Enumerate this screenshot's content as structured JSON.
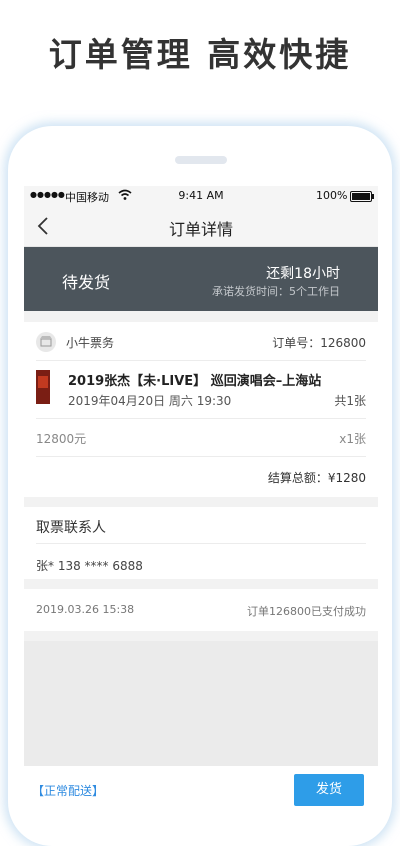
{
  "headline": "订单管理 高效快捷",
  "statusbar": {
    "signal": "●●●●●",
    "carrier": "中国移动",
    "time": "9:41 AM",
    "battery": "100%"
  },
  "navbar": {
    "title": "订单详情"
  },
  "order_status": {
    "state": "待发货",
    "remaining": "还剩18小时",
    "promise": "承诺发货时间：5个工作日"
  },
  "order": {
    "shop_name": "小牛票务",
    "order_number": "订单号：126800",
    "event_title": "2019张杰【未·LIVE】 巡回演唱会–上海站",
    "event_date": "2019年04月20日 周六 19:30",
    "ticket_count": "共1张",
    "price": "12800元",
    "quantity": "x1张",
    "total": "结算总额：¥1280"
  },
  "contact": {
    "title": "取票联系人",
    "info": "张*  138 **** 6888"
  },
  "payment": {
    "time": "2019.03.26 15:38",
    "status": "订单126800已支付成功"
  },
  "bottom": {
    "delivery": "【正常配送】",
    "ship_button": "发货"
  },
  "colors": {
    "status_panel": "#4c555c",
    "accent_blue": "#2e9de8"
  }
}
